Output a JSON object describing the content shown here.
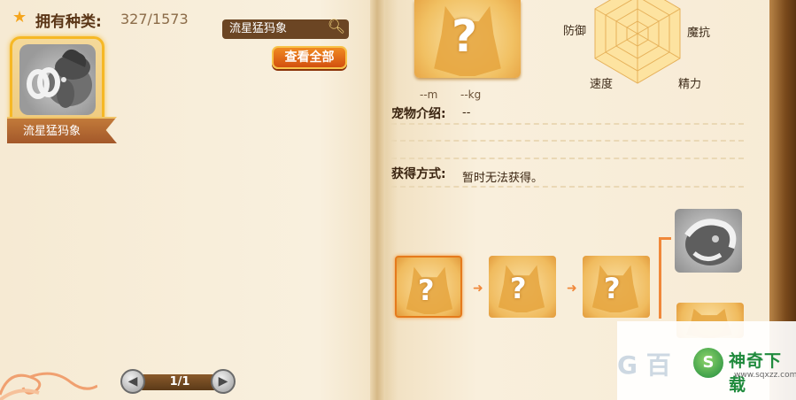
{
  "left_page": {
    "species_label": "拥有种类:",
    "species_count": "327/1573",
    "search_value": "流星猛犸象",
    "view_all_label": "查看全部",
    "pet_card": {
      "name": "流星猛犸象"
    },
    "pagination": {
      "text": "1/1",
      "prev_icon": "◀",
      "next_icon": "▶"
    }
  },
  "right_page": {
    "portrait_symbol": "?",
    "height_text": "--m",
    "weight_text": "--kg",
    "radar_labels": {
      "defense": "防御",
      "magic_resist": "魔抗",
      "speed": "速度",
      "energy": "精力"
    },
    "intro_label": "宠物介绍:",
    "intro_value": "--",
    "obtain_label": "获得方式:",
    "obtain_value": "暂时无法获得。",
    "evolution_symbol": "?"
  },
  "watermark": {
    "ghost_text": "G 百",
    "name": "神奇下载",
    "url": "www.sqxzz.com",
    "logo": "S"
  },
  "colors": {
    "accent": "#f08a22",
    "star": "#f5a51c",
    "card_border": "#f6b825",
    "brand_green": "#1f8a3c"
  }
}
